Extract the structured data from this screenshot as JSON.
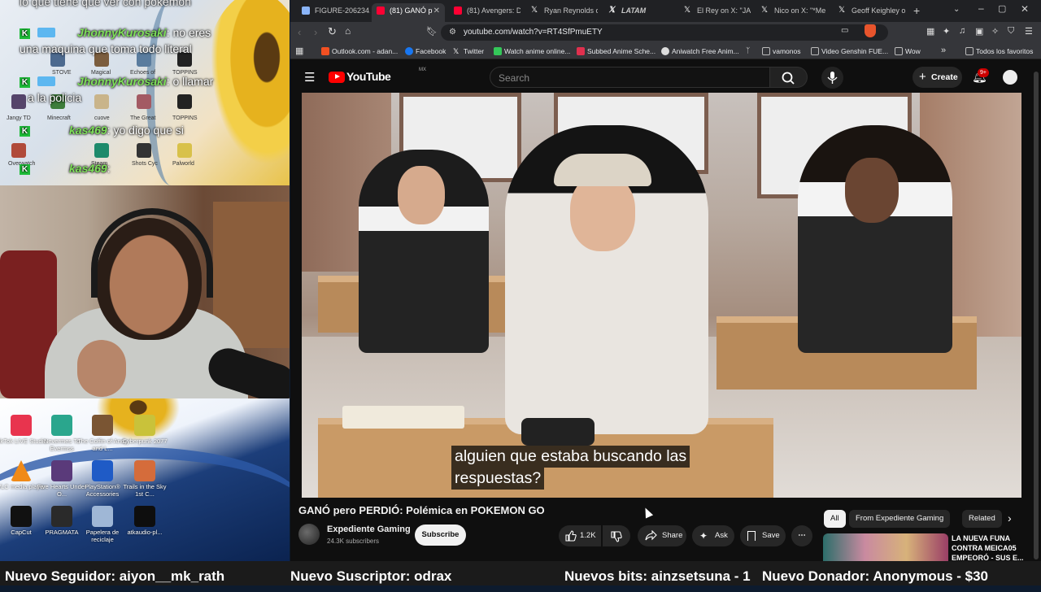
{
  "chat": {
    "top_partial": "lo que tiene que ver con pokemon",
    "messages": [
      {
        "user": "JhonnyKurosaki",
        "text": ": no eres"
      },
      {
        "user": "",
        "text": "una maquina que toma todo literal"
      },
      {
        "user": "JhonnyKurosaki",
        "text": ": o llamar"
      },
      {
        "user": "",
        "text": "a la policia"
      },
      {
        "user": "kas469",
        "text": ": yo digo que si"
      },
      {
        "user": "kas469",
        "text": ":"
      }
    ]
  },
  "overlay_desktop_labels": [
    "STOVE",
    "Magical",
    "Echoes of",
    "TOPPINS",
    "Jangy TD",
    "Minecraft",
    "cuove",
    "The Great",
    "TOPPINS",
    "Overwatch",
    "Steam",
    "Shots Cyc",
    "Palworld"
  ],
  "desktop_icons": [
    {
      "label": "TikTok LIVE Studio",
      "color": "#e8344e"
    },
    {
      "label": "Nevermes To Evermss",
      "color": "#2aa68d"
    },
    {
      "label": "The Coffin of Andy and L...",
      "color": "#7a5533"
    },
    {
      "label": "Cyberpunk 2077",
      "color": "#c9c23a"
    },
    {
      "label": "VLC media player",
      "color": "#f08a18"
    },
    {
      "label": "Five Hearts Under O...",
      "color": "#5a3a7a"
    },
    {
      "label": "PlayStation® Accessories",
      "color": "#1f5bc6"
    },
    {
      "label": "Trails in the Sky 1st C...",
      "color": "#d56c3b"
    },
    {
      "label": "CapCut",
      "color": "#111111"
    },
    {
      "label": "PRAGMATA",
      "color": "#2a2a2a"
    },
    {
      "label": "Papelera de reciclaje",
      "color": "#9fb7d6"
    },
    {
      "label": "atkaudio-pl...",
      "color": "#0e0e0e"
    }
  ],
  "browser": {
    "tabs": [
      {
        "label": "FIGURE-206234.j",
        "icon": "page-icon",
        "color": "#8ab4f8"
      },
      {
        "label": "(81) GANÓ p",
        "icon": "youtube-icon",
        "color": "#ff0033",
        "active": true
      },
      {
        "label": "(81) Avengers: Do",
        "icon": "youtube-icon",
        "color": "#ff0033"
      },
      {
        "label": "Ryan Reynolds o",
        "icon": "x-icon",
        "color": "#ffffff"
      },
      {
        "label": "LATAM",
        "icon": "x-icon",
        "color": "#ffffff"
      },
      {
        "label": "El Rey on X: \"JAJ",
        "icon": "x-icon",
        "color": "#ffffff"
      },
      {
        "label": "Nico on X: \"*Me",
        "icon": "x-icon",
        "color": "#ffffff"
      },
      {
        "label": "Geoff Keighley o",
        "icon": "x-icon",
        "color": "#ffffff"
      }
    ],
    "url": "youtube.com/watch?v=RT4SfPmuETY",
    "bookmarks": [
      {
        "label": "Outlook.com - adan...",
        "color": "#f25022"
      },
      {
        "label": "Facebook",
        "color": "#1877f2"
      },
      {
        "label": "Twitter",
        "color": "#ffffff"
      },
      {
        "label": "Watch anime online...",
        "color": "#34c759"
      },
      {
        "label": "Subbed Anime Sche...",
        "color": "#e0304e"
      },
      {
        "label": "Aniwatch Free Anim...",
        "color": "#dddddd"
      },
      {
        "label": "vamonos",
        "color": "#bbbbbb"
      },
      {
        "label": "Video Genshin FUE...",
        "color": "#bbbbbb"
      },
      {
        "label": "Wow",
        "color": "#bbbbbb"
      }
    ],
    "bookmarks_all": "Todos los favoritos"
  },
  "youtube": {
    "logo": "YouTube",
    "region": "MX",
    "search_placeholder": "Search",
    "create": "Create",
    "notifications": "9+",
    "subtitle_lines": [
      "alguien que estaba buscando las",
      "respuestas?"
    ],
    "video_title": "GANÓ pero PERDIÓ: Polémica en POKEMON GO",
    "channel": "Expediente Gaming",
    "subscribers": "24.3K subscribers",
    "subscribe": "Subscribe",
    "likes": "1.2K",
    "share": "Share",
    "ask": "Ask",
    "save": "Save",
    "chips": [
      "All",
      "From Expediente Gaming",
      "Related"
    ],
    "related_title": [
      "LA NUEVA FUNA",
      "CONTRA MEICA05",
      "EMPEORÓ - SUS E..."
    ]
  },
  "ticker": [
    "Nuevo Seguidor: aiyon__mk_rath",
    "Nuevo Suscriptor: odrax",
    "Nuevos bits: ainzsetsuna - 1",
    "Nuevo Donador: Anonymous - $30"
  ]
}
